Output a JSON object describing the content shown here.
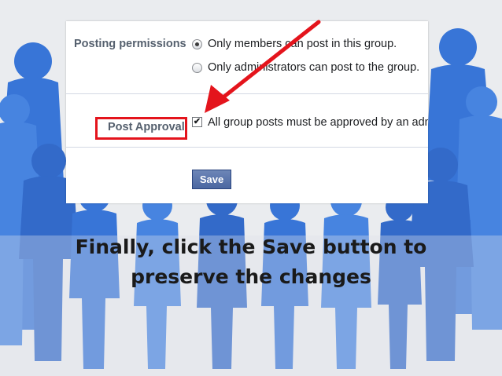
{
  "settings": {
    "posting_permissions_label": "Posting permissions",
    "options": [
      {
        "label": "Only members can post in this group.",
        "selected": true
      },
      {
        "label": "Only administrators can post to the group.",
        "selected": false
      }
    ],
    "post_approval_label": "Post Approval",
    "post_approval_text": "All group posts must be approved by an adm",
    "post_approval_checked": true,
    "save_label": "Save"
  },
  "caption": {
    "line1": "Finally, click the Save button to",
    "line2": "preserve the changes"
  },
  "colors": {
    "silhouette": "#2f6fd6",
    "highlight": "#e4141c",
    "arrow": "#e4141c",
    "button": "#4b67a1"
  }
}
